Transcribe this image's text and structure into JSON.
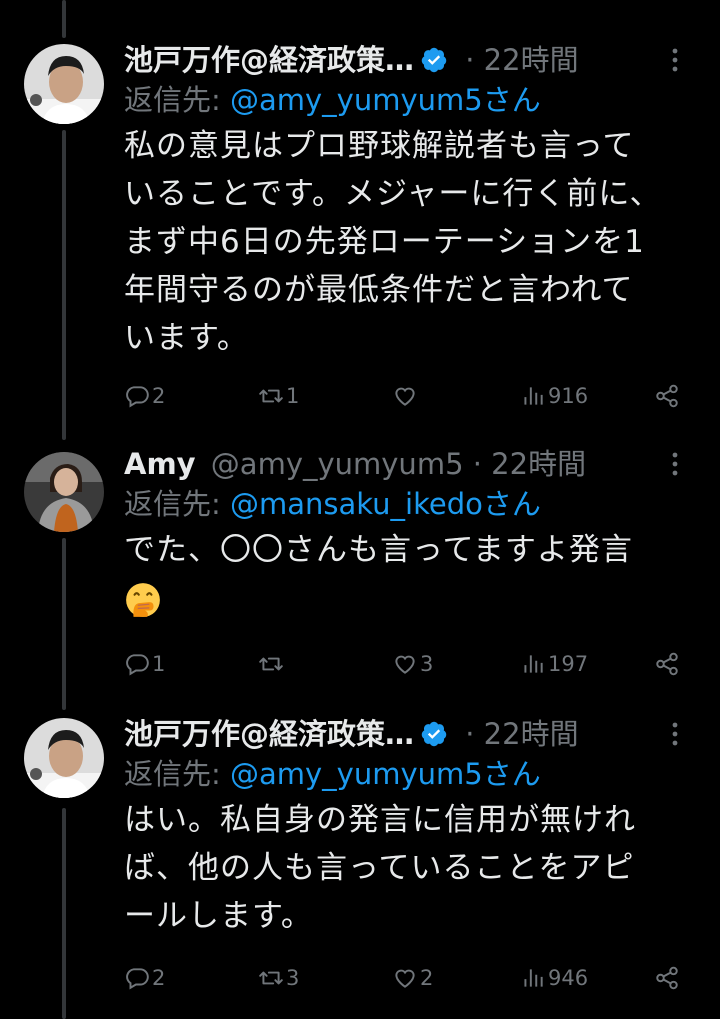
{
  "colors": {
    "background": "#000000",
    "text": "#e7e9ea",
    "muted": "#71767b",
    "link": "#1d9bf0",
    "verified": "#1d9bf0",
    "thread_line": "#333639"
  },
  "tweets": [
    {
      "display_name": "池戸万作@経済政策…",
      "handle": "",
      "verified": true,
      "dot": "·",
      "time": "22時間",
      "reply_prefix": "返信先: ",
      "reply_mention": "@amy_yumyum5さん",
      "body_lines": [
        "私の意見はプロ野球解説者も言って",
        "いることです。メジャーに行く前に、",
        "まず中6日の先発ローテーションを1",
        "年間守るのが最低条件だと言われて",
        "います。"
      ],
      "stats": {
        "replies": "2",
        "retweets": "1",
        "likes": "",
        "views": "916"
      },
      "icons": [
        "reply-icon",
        "retweet-icon",
        "like-icon",
        "views-icon",
        "share-icon"
      ]
    },
    {
      "display_name": "Amy",
      "handle": "@amy_yumyum5",
      "verified": false,
      "dot": "·",
      "time": "22時間",
      "reply_prefix": "返信先: ",
      "reply_mention": "@mansaku_ikedoさん",
      "body_lines": [
        "でた、〇〇さんも言ってますよ発言"
      ],
      "emoji": "face-with-hand-over-mouth-emoji",
      "stats": {
        "replies": "1",
        "retweets": "",
        "likes": "3",
        "views": "197"
      },
      "icons": [
        "reply-icon",
        "retweet-icon",
        "like-icon",
        "views-icon",
        "share-icon"
      ]
    },
    {
      "display_name": "池戸万作@経済政策…",
      "handle": "",
      "verified": true,
      "dot": "·",
      "time": "22時間",
      "reply_prefix": "返信先: ",
      "reply_mention": "@amy_yumyum5さん",
      "body_lines": [
        "はい。私自身の発言に信用が無けれ",
        "ば、他の人も言っていることをアピ",
        "ールします。"
      ],
      "stats": {
        "replies": "2",
        "retweets": "3",
        "likes": "2",
        "views": "946"
      },
      "icons": [
        "reply-icon",
        "retweet-icon",
        "like-icon",
        "views-icon",
        "share-icon"
      ]
    }
  ]
}
